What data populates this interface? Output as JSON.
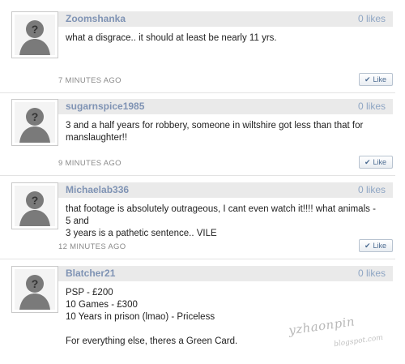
{
  "comments": [
    {
      "username": "Zoomshanka",
      "likes": "0 likes",
      "lines": [
        "what a disgrace.. it should at least be nearly 11 yrs."
      ],
      "time": "7 MINUTES AGO",
      "like_label": "Like"
    },
    {
      "username": "sugarnspice1985",
      "likes": "0 likes",
      "lines": [
        "3 and a half years for robbery, someone in wiltshire got less than that for",
        "manslaughter!!"
      ],
      "time": "9 MINUTES AGO",
      "like_label": "Like"
    },
    {
      "username": "Michaelab336",
      "likes": "0 likes",
      "lines": [
        "that footage is absolutely outrageous, I cant even watch it!!!! what animals - 5 and",
        "3 years is a pathetic sentence.. VILE"
      ],
      "time": "12 MINUTES AGO",
      "like_label": "Like"
    },
    {
      "username": "Blatcher21",
      "likes": "0 likes",
      "lines": [
        "PSP - £200",
        "10 Games - £300",
        "10 Years in prison (lmao) - Priceless",
        "",
        "For everything else, theres a Green Card."
      ],
      "time": "",
      "like_label": ""
    }
  ],
  "watermark": "yzhaonpin",
  "watermark_sub": "blogspot.com",
  "icons": {
    "avatar": "default-avatar-icon",
    "like": "check-icon"
  }
}
